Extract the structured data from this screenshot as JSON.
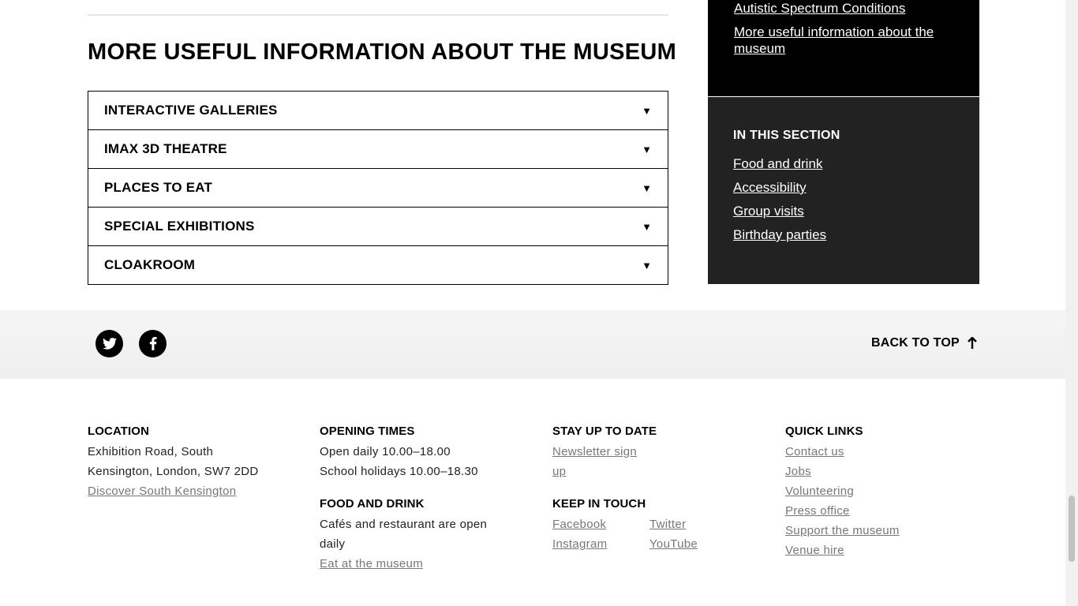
{
  "main": {
    "section_title": "MORE USEFUL INFORMATION ABOUT THE MUSEUM",
    "accordion": [
      {
        "label": "INTERACTIVE GALLERIES"
      },
      {
        "label": "IMAX 3D THEATRE"
      },
      {
        "label": "PLACES TO EAT"
      },
      {
        "label": "SPECIAL EXHIBITIONS"
      },
      {
        "label": "CLOAKROOM"
      }
    ],
    "arrow_glyph": "▼"
  },
  "sidebar": {
    "top_links": [
      {
        "label": "Autistic Spectrum Conditions"
      },
      {
        "label": "More useful information about the museum"
      }
    ],
    "in_section_title": "IN THIS SECTION",
    "section_links": [
      {
        "label": "Food and drink"
      },
      {
        "label": "Accessibility"
      },
      {
        "label": "Group visits"
      },
      {
        "label": "Birthday parties"
      }
    ]
  },
  "social_strip": {
    "icons": [
      "twitter-icon",
      "facebook-icon"
    ],
    "back_to_top": "BACK TO TOP"
  },
  "footer": {
    "location": {
      "heading": "LOCATION",
      "address_1": "Exhibition Road, South",
      "address_2": "Kensington, London, SW7 2DD",
      "link": "Discover South Kensington"
    },
    "opening": {
      "heading": "OPENING TIMES",
      "line_1": "Open daily 10.00–18.00",
      "line_2": "School holidays 10.00–18.30"
    },
    "food": {
      "heading": "FOOD AND DRINK",
      "line_1": "Cafés and restaurant are open daily",
      "link": "Eat at the museum"
    },
    "stay": {
      "heading": "STAY UP TO DATE",
      "link": "Newsletter sign up"
    },
    "keep_in_touch": {
      "heading": "KEEP IN TOUCH",
      "links": [
        {
          "label": "Facebook"
        },
        {
          "label": "Twitter"
        },
        {
          "label": "Instagram"
        },
        {
          "label": "YouTube"
        }
      ]
    },
    "quick_links": {
      "heading": "QUICK LINKS",
      "links": [
        {
          "label": "Contact us"
        },
        {
          "label": "Jobs"
        },
        {
          "label": "Volunteering"
        },
        {
          "label": "Press office"
        },
        {
          "label": "Support the museum"
        },
        {
          "label": "Venue hire"
        }
      ]
    }
  },
  "colors": {
    "sidebar_black": "#000000",
    "sidebar_grey": "#222222",
    "strip_bg": "#f2f2f2",
    "footer_link": "#777777"
  }
}
